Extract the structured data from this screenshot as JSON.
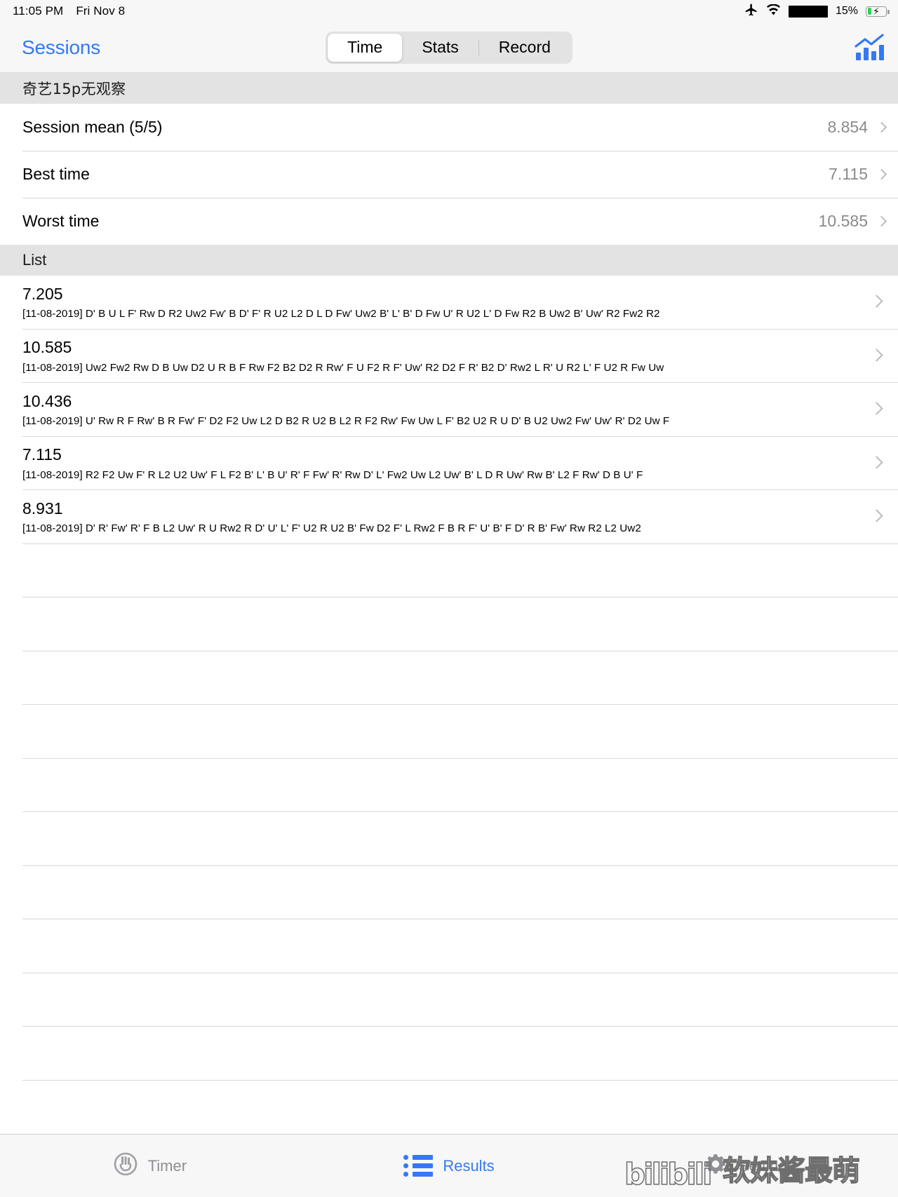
{
  "status_bar": {
    "time": "11:05 PM",
    "date": "Fri Nov 8",
    "battery_percent": "15%",
    "icons": [
      "airplane-mode-icon",
      "wifi-icon",
      "redacted-block",
      "battery-charging-icon"
    ]
  },
  "nav": {
    "back_label": "Sessions",
    "segments": [
      {
        "label": "Time",
        "selected": true
      },
      {
        "label": "Stats",
        "selected": false
      },
      {
        "label": "Record",
        "selected": false
      }
    ],
    "right_icon": "bar-chart-icon"
  },
  "session": {
    "header": "奇艺15p无观察",
    "summary": [
      {
        "label": "Session mean (5/5)",
        "value": "8.854"
      },
      {
        "label": "Best time",
        "value": "7.115"
      },
      {
        "label": "Worst time",
        "value": "10.585"
      }
    ]
  },
  "list": {
    "header": "List",
    "items": [
      {
        "time": "7.205",
        "date": "[11-08-2019]",
        "scramble": "D' B U L F' Rw D R2 Uw2 Fw' B D' F' R U2 L2 D L D Fw' Uw2 B' L' B' D Fw U' R U2 L' D Fw R2 B Uw2 B' Uw' R2 Fw2 R2"
      },
      {
        "time": "10.585",
        "date": "[11-08-2019]",
        "scramble": "Uw2 Fw2 Rw D B Uw D2 U R B F Rw F2 B2 D2 R Rw' F U F2 R F' Uw' R2 D2 F R' B2 D' Rw2 L R' U R2 L' F U2 R Fw Uw"
      },
      {
        "time": "10.436",
        "date": "[11-08-2019]",
        "scramble": "U' Rw R F Rw' B R Fw' F' D2 F2 Uw L2 D B2 R U2 B L2 R F2 Rw' Fw Uw L F' B2 U2 R U D' B U2 Uw2 Fw' Uw' R' D2 Uw F"
      },
      {
        "time": "7.115",
        "date": "[11-08-2019]",
        "scramble": "R2 F2 Uw F' R L2 U2 Uw' F L F2 B' L' B U' R' F Fw' R' Rw D' L' Fw2 Uw L2 Uw' B' L D R Uw' Rw B' L2 F Rw' D B U' F"
      },
      {
        "time": "8.931",
        "date": "[11-08-2019]",
        "scramble": "D' R' Fw' R' F B L2 Uw' R U Rw2 R D' U' L' F' U2 R U2 B' Fw D2 F' L Rw2 F B R F' U' B' F D' R B' Fw' Rw R2 L2 Uw2"
      }
    ],
    "empty_row_count": 10
  },
  "tabbar": {
    "tabs": [
      {
        "label": "Timer",
        "icon": "stopwatch-icon",
        "active": false
      },
      {
        "label": "Results",
        "icon": "list-icon",
        "active": true
      },
      {
        "label": "Settings",
        "icon": "gear-icon",
        "active": false
      }
    ]
  },
  "watermark": {
    "brand": "bilibili",
    "text": "软妹酱最萌"
  },
  "colors": {
    "accent": "#3478f6",
    "section_header_bg": "#e3e3e3",
    "secondary_text": "#8a8a8e"
  }
}
